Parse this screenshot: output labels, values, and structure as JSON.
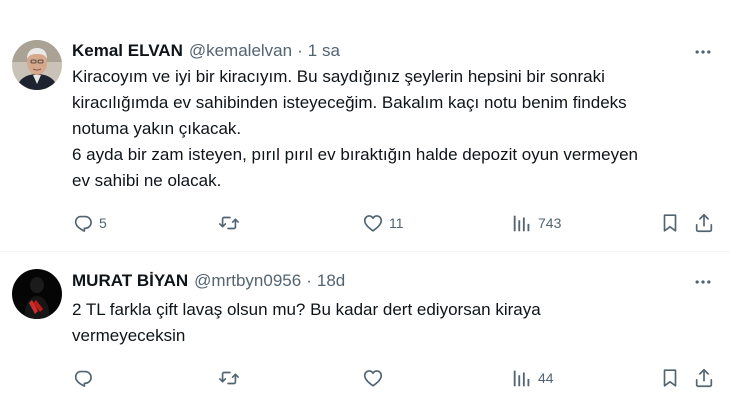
{
  "tweets": [
    {
      "author_name": "Kemal ELVAN",
      "handle": "@kemalelvan",
      "separator": "·",
      "time": "1 sa",
      "text_lines": [
        "Kiracoyım ve iyi bir kiracıyım. Bu saydığınız şeylerin hepsini bir sonraki",
        "kiracılığımda ev sahibinden isteyeceğim. Bakalım kaçı notu benim findeks",
        "notuma yakın çıkacak.",
        "6 ayda bir zam isteyen, pırıl pırıl ev bıraktığın halde depozit oyun vermeyen",
        "ev sahibi ne olacak."
      ],
      "replies": "5",
      "retweets": "",
      "likes": "11",
      "views": "743"
    },
    {
      "author_name": "MURAT BİYAN",
      "handle": "@mrtbyn0956",
      "separator": "·",
      "time": "18d",
      "text_lines": [
        "2 TL farkla çift lavaş olsun mu? Bu kadar dert ediyorsan kiraya",
        "vermeyeceksin"
      ],
      "replies": "",
      "retweets": "",
      "likes": "",
      "views": "44"
    }
  ],
  "colors": {
    "text": "#0f1419",
    "secondary": "#536471",
    "divider": "#eff3f4"
  },
  "icons": [
    "reply-icon",
    "retweet-icon",
    "like-icon",
    "views-icon",
    "bookmark-icon",
    "share-icon",
    "more-icon"
  ]
}
